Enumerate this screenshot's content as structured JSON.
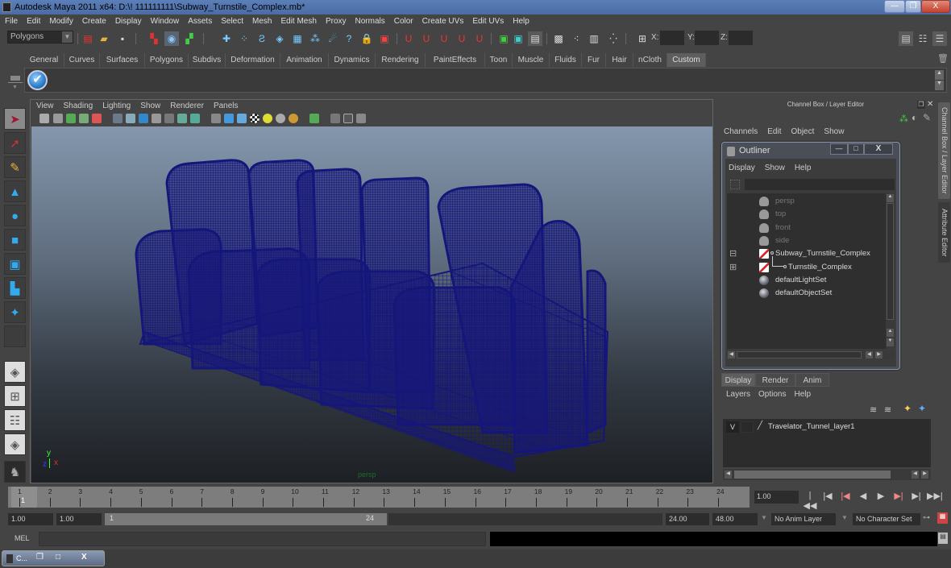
{
  "window": {
    "title": "Autodesk Maya 2011 x64: D:\\! 111111111\\Subway_Turnstile_Complex.mb*",
    "minimize": "—",
    "maximize": "❐",
    "close": "X"
  },
  "menubar": [
    "File",
    "Edit",
    "Modify",
    "Create",
    "Display",
    "Window",
    "Assets",
    "Select",
    "Mesh",
    "Edit Mesh",
    "Proxy",
    "Normals",
    "Color",
    "Create UVs",
    "Edit UVs",
    "Help"
  ],
  "status_line": {
    "mode": "Polygons",
    "x_label": "X:",
    "y_label": "Y:",
    "z_label": "Z:",
    "x_value": "",
    "y_value": "",
    "z_value": ""
  },
  "shelf": {
    "tabs": [
      "General",
      "Curves",
      "Surfaces",
      "Polygons",
      "Subdivs",
      "Deformation",
      "Animation",
      "Dynamics",
      "Rendering",
      "PaintEffects",
      "Toon",
      "Muscle",
      "Fluids",
      "Fur",
      "Hair",
      "nCloth",
      "Custom"
    ],
    "active_tab": "Custom"
  },
  "viewport": {
    "menu": [
      "View",
      "Shading",
      "Lighting",
      "Show",
      "Renderer",
      "Panels"
    ],
    "camera_label": "persp",
    "axis": {
      "y": "y",
      "x": "x",
      "z": "z"
    },
    "wireframe_color": "#15167a"
  },
  "channel_box": {
    "title": "Channel Box / Layer Editor",
    "menu": [
      "Channels",
      "Edit",
      "Object",
      "Show"
    ]
  },
  "side_tabs": [
    "Channel Box / Layer Editor",
    "Attribute Editor"
  ],
  "outliner": {
    "title": "Outliner",
    "menu": [
      "Display",
      "Show",
      "Help"
    ],
    "filter": "",
    "items": [
      {
        "label": "persp",
        "type": "camera",
        "dim": true
      },
      {
        "label": "top",
        "type": "camera",
        "dim": true
      },
      {
        "label": "front",
        "type": "camera",
        "dim": true
      },
      {
        "label": "side",
        "type": "camera",
        "dim": true
      },
      {
        "label": "Subway_Turnstile_Complex",
        "type": "group",
        "expanded": true
      },
      {
        "label": "Turnstile_Complex",
        "type": "group",
        "expanded": false
      },
      {
        "label": "defaultLightSet",
        "type": "set"
      },
      {
        "label": "defaultObjectSet",
        "type": "set"
      }
    ]
  },
  "layer_editor": {
    "tabs": [
      "Display",
      "Render",
      "Anim"
    ],
    "active_tab": "Display",
    "menu": [
      "Layers",
      "Options",
      "Help"
    ],
    "layers": [
      {
        "visible": "V",
        "name": "Travelator_Tunnel_layer1"
      }
    ]
  },
  "time_slider": {
    "ticks": [
      "1",
      "2",
      "3",
      "4",
      "5",
      "6",
      "7",
      "8",
      "9",
      "10",
      "11",
      "12",
      "13",
      "14",
      "15",
      "16",
      "17",
      "18",
      "19",
      "20",
      "21",
      "22",
      "23",
      "24"
    ],
    "current_frame_marker": "1",
    "current_time": "1.00"
  },
  "playback": [
    "|◀◀",
    "|◀",
    "|◀",
    "◀",
    "▶",
    "▶|",
    "▶|",
    "▶▶|"
  ],
  "range_slider": {
    "start_time": "1.00",
    "playback_start": "1.00",
    "range_start": "1",
    "range_end": "24",
    "playback_end": "24.00",
    "end_time": "48.00",
    "anim_layer": "No Anim Layer",
    "character_set": "No Character Set"
  },
  "command_line": {
    "label": "MEL",
    "input": "",
    "result": ""
  },
  "taskbar": {
    "item": "C..."
  }
}
